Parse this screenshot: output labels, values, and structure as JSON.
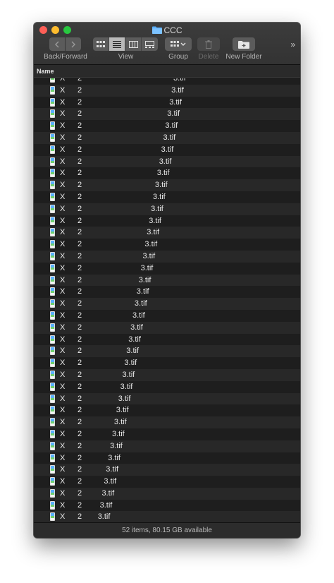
{
  "window": {
    "title": "CCC",
    "colors": {
      "close": "#fe5f57",
      "minimize": "#febc2e",
      "maximize": "#28c840",
      "folder": "#5ab0ff"
    }
  },
  "toolbar": {
    "back_forward_label": "Back/Forward",
    "view_label": "View",
    "group_label": "Group",
    "delete_label": "Delete",
    "new_folder_label": "New Folder",
    "overflow": "»",
    "view_modes": [
      "icon-view-icon",
      "list-view-icon",
      "column-view-icon",
      "gallery-view-icon"
    ],
    "selected_view": "list-view-icon"
  },
  "list": {
    "header_name": "Name",
    "rows": [
      {
        "a": "X",
        "b": "2",
        "name": "3.tif"
      },
      {
        "a": "X",
        "b": "2",
        "name": "3.tif"
      },
      {
        "a": "X",
        "b": "2",
        "name": "3.tif"
      },
      {
        "a": "X",
        "b": "2",
        "name": "3.tif"
      },
      {
        "a": "X",
        "b": "2",
        "name": "3.tif"
      },
      {
        "a": "X",
        "b": "2",
        "name": "3.tif"
      },
      {
        "a": "X",
        "b": "2",
        "name": "3.tif"
      },
      {
        "a": "X",
        "b": "2",
        "name": "3.tif"
      },
      {
        "a": "X",
        "b": "2",
        "name": "3.tif"
      },
      {
        "a": "X",
        "b": "2",
        "name": "3.tif"
      },
      {
        "a": "X",
        "b": "2",
        "name": "3.tif"
      },
      {
        "a": "X",
        "b": "2",
        "name": "3.tif"
      },
      {
        "a": "X",
        "b": "2",
        "name": "3.tif"
      },
      {
        "a": "X",
        "b": "2",
        "name": "3.tif"
      },
      {
        "a": "X",
        "b": "2",
        "name": "3.tif"
      },
      {
        "a": "X",
        "b": "2",
        "name": "3.tif"
      },
      {
        "a": "X",
        "b": "2",
        "name": "3.tif"
      },
      {
        "a": "X",
        "b": "2",
        "name": "3.tif"
      },
      {
        "a": "X",
        "b": "2",
        "name": "3.tif"
      },
      {
        "a": "X",
        "b": "2",
        "name": "3.tif"
      },
      {
        "a": "X",
        "b": "2",
        "name": "3.tif"
      },
      {
        "a": "X",
        "b": "2",
        "name": "3.tif"
      },
      {
        "a": "X",
        "b": "2",
        "name": "3.tif"
      },
      {
        "a": "X",
        "b": "2",
        "name": "3.tif"
      },
      {
        "a": "X",
        "b": "2",
        "name": "3.tif"
      },
      {
        "a": "X",
        "b": "2",
        "name": "3.tif"
      },
      {
        "a": "X",
        "b": "2",
        "name": "3.tif"
      },
      {
        "a": "X",
        "b": "2",
        "name": "3.tif"
      },
      {
        "a": "X",
        "b": "2",
        "name": "3.tif"
      },
      {
        "a": "X",
        "b": "2",
        "name": "3.tif"
      },
      {
        "a": "X",
        "b": "2",
        "name": "3.tif"
      },
      {
        "a": "X",
        "b": "2",
        "name": "3.tif"
      },
      {
        "a": "X",
        "b": "2",
        "name": "3.tif"
      },
      {
        "a": "X",
        "b": "2",
        "name": "3.tif"
      },
      {
        "a": "X",
        "b": "2",
        "name": "3.tif"
      },
      {
        "a": "X",
        "b": "2",
        "name": "3.tif"
      },
      {
        "a": "X",
        "b": "2",
        "name": "3.tif"
      },
      {
        "a": "X",
        "b": "2",
        "name": "3.tif"
      }
    ]
  },
  "status": {
    "text": "52 items, 80.15 GB available"
  }
}
